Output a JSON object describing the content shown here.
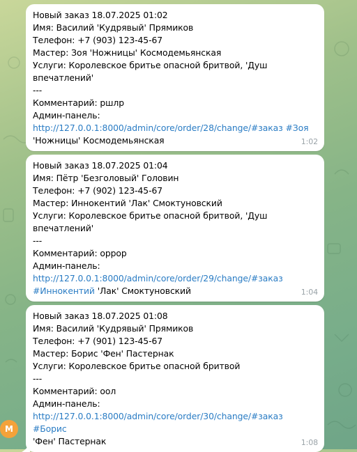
{
  "messages": [
    {
      "header": "Новый заказ 18.07.2025 01:02",
      "name": "Имя: Василий 'Кудрявый' Прямиков",
      "phone": "Телефон: +7 (903) 123-45-67",
      "master": "Мастер: Зоя 'Ножницы' Космодемьянская",
      "services_1": "Услуги: Королевское бритье опасной бритвой, 'Душ",
      "services_2": "впечатлений'",
      "separator": "---",
      "comment": "Комментарий: ршлр",
      "admin_label": "Админ-панель:",
      "link": "http://127.0.0.1:8000/admin/core/order/28/change/",
      "tags": "#заказ #Зоя",
      "tail_text": "'Ножницы' Космодемьянская",
      "time": "1:02"
    },
    {
      "header": "Новый заказ 18.07.2025 01:04",
      "name": "Имя: Пётр 'Безголовый' Головин",
      "phone": "Телефон: +7 (902) 123-45-67",
      "master": "Мастер: Иннокентий 'Лак' Смоктуновский",
      "services_1": "Услуги: Королевское бритье опасной бритвой, 'Душ",
      "services_2": "впечатлений'",
      "separator": "---",
      "comment": "Комментарий: оррор",
      "admin_label": "Админ-панель:",
      "link": "http://127.0.0.1:8000/admin/core/order/29/change/",
      "tags": "#заказ",
      "tags_2": "#Иннокентий",
      "tail_text": " 'Лак' Смоктуновский",
      "time": "1:04"
    },
    {
      "header": "Новый заказ 18.07.2025 01:08",
      "name": "Имя: Василий 'Кудрявый' Прямиков",
      "phone": "Телефон: +7 (901) 123-45-67",
      "master": "Мастер: Борис 'Фен' Пастернак",
      "services_1": "Услуги: Королевское бритье опасной бритвой",
      "separator": "---",
      "comment": "Комментарий: оол",
      "admin_label": "Админ-панель:",
      "link": "http://127.0.0.1:8000/admin/core/order/30/change/",
      "tags": "#заказ #Борис",
      "tail_text": "'Фен' Пастернак",
      "time": "1:08"
    }
  ],
  "avatar": {
    "letter": "М",
    "color": "#f4a23a"
  }
}
